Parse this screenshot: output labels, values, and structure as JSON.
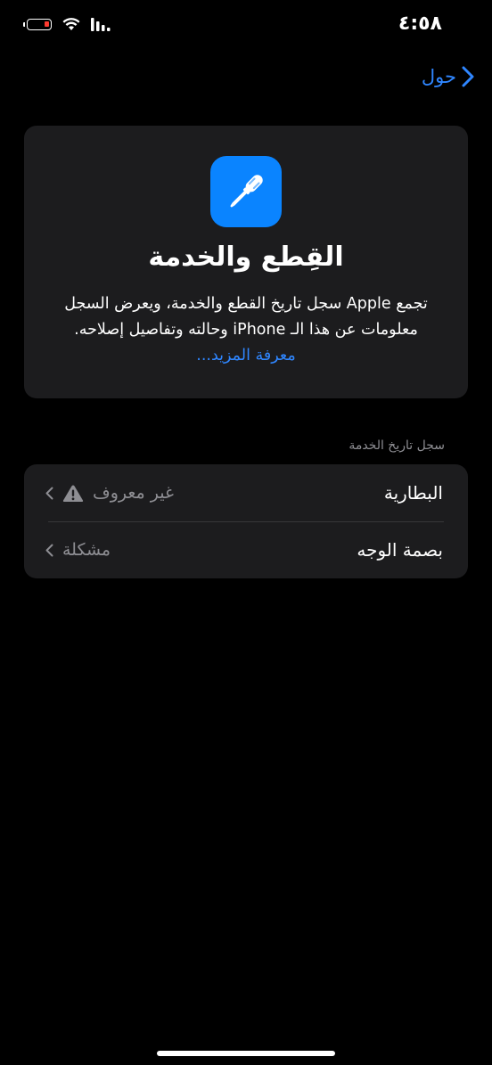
{
  "status_bar": {
    "time": "٤:٥٨",
    "battery_level": 0.15,
    "battery_color": "#ff3b30"
  },
  "nav": {
    "back_label": "حول",
    "accent": "#2f86ff"
  },
  "header": {
    "icon": "screwdriver-icon",
    "icon_bg": "#0a84ff",
    "title": "القِطع والخدمة",
    "description": "تجمع Apple سجل تاريخ القطع والخدمة، ويعرض السجل معلومات عن هذا الـ iPhone وحالته وتفاصيل إصلاحه.",
    "link": "معرفة المزيد..."
  },
  "service_history": {
    "section_title": "سجل تاريخ الخدمة",
    "items": [
      {
        "label": "البطارية",
        "value": "غير معروف",
        "icon": "warning-icon"
      },
      {
        "label": "بصمة الوجه",
        "value": "مشكلة",
        "icon": ""
      }
    ]
  }
}
